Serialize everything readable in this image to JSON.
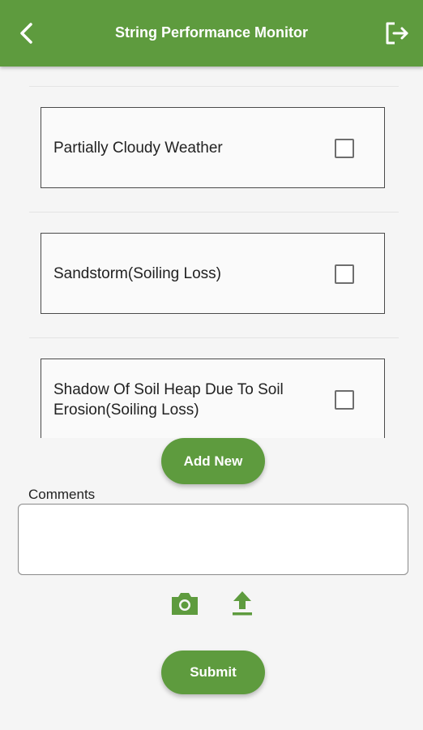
{
  "appbar": {
    "title": "String Performance Monitor",
    "back_icon": "back-chevron-icon",
    "logout_icon": "logout-icon"
  },
  "options": [
    {
      "label": "Partially Cloudy Weather",
      "checked": false
    },
    {
      "label": "Sandstorm(Soiling Loss)",
      "checked": false
    },
    {
      "label": "Shadow Of Soil Heap Due To Soil Erosion(Soiling Loss)",
      "checked": false
    }
  ],
  "add_new_label": "Add New",
  "comments": {
    "label": "Comments",
    "value": ""
  },
  "attachments": {
    "camera_icon": "camera-icon",
    "upload_icon": "upload-icon"
  },
  "submit_label": "Submit",
  "colors": {
    "accent": "#5e9b3e",
    "background": "#f5f5f5"
  }
}
